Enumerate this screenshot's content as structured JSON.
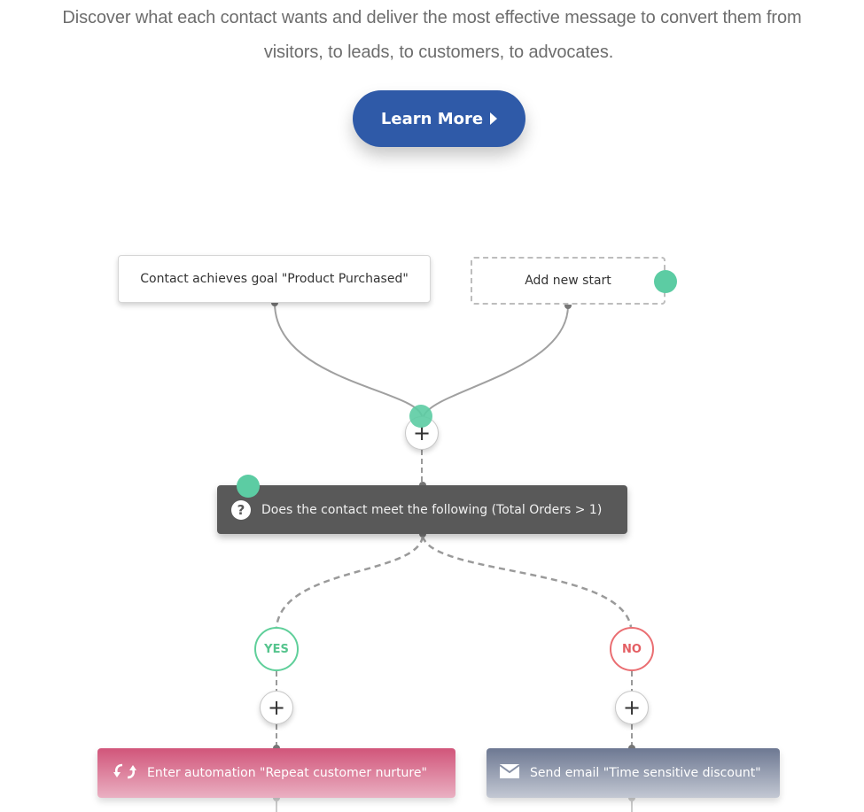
{
  "intro": {
    "line1": "Discover what each contact wants and deliver the most effective message to convert them from",
    "line2": "visitors, to leads, to customers, to advocates."
  },
  "cta": {
    "label": "Learn More",
    "icon": "caret-right-icon",
    "color": "#2f5aa8"
  },
  "workflow": {
    "starts": [
      {
        "label": "Contact achieves goal \"Product Purchased\""
      },
      {
        "label": "Add new start"
      }
    ],
    "condition": {
      "icon": "question-icon",
      "glyph": "?",
      "label": "Does the contact meet the following (Total Orders > 1)"
    },
    "branches": {
      "yes": {
        "label": "YES",
        "color": "#5fcf9a"
      },
      "no": {
        "label": "NO",
        "color": "#ea6e72"
      }
    },
    "add_step_glyph": "+",
    "actions": [
      {
        "icon": "refresh-icon",
        "label": "Enter automation \"Repeat customer nurture\""
      },
      {
        "icon": "envelope-icon",
        "label": "Send email \"Time sensitive discount\""
      }
    ],
    "accent_green": "#5ccca3"
  }
}
